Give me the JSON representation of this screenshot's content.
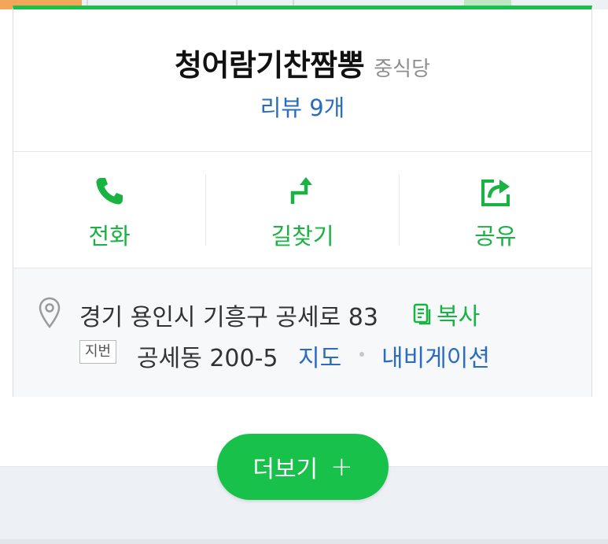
{
  "place": {
    "name": "청어람기찬짬뽕",
    "category": "중식당",
    "review_link": "리뷰 9개"
  },
  "actions": [
    {
      "label": "전화",
      "icon": "phone-icon"
    },
    {
      "label": "길찾기",
      "icon": "directions-icon"
    },
    {
      "label": "공유",
      "icon": "share-icon"
    }
  ],
  "address": {
    "road": "경기 용인시 기흥구 공세로 83",
    "copy_label": "복사",
    "jibeon_badge": "지번",
    "jibeon": "공세동 200-5",
    "map_link": "지도",
    "navigation_link": "내비게이션"
  },
  "more_button": {
    "label": "더보기",
    "plus": "+"
  },
  "colors": {
    "accent_green": "#18c24a",
    "link_blue": "#2a6dc0"
  }
}
